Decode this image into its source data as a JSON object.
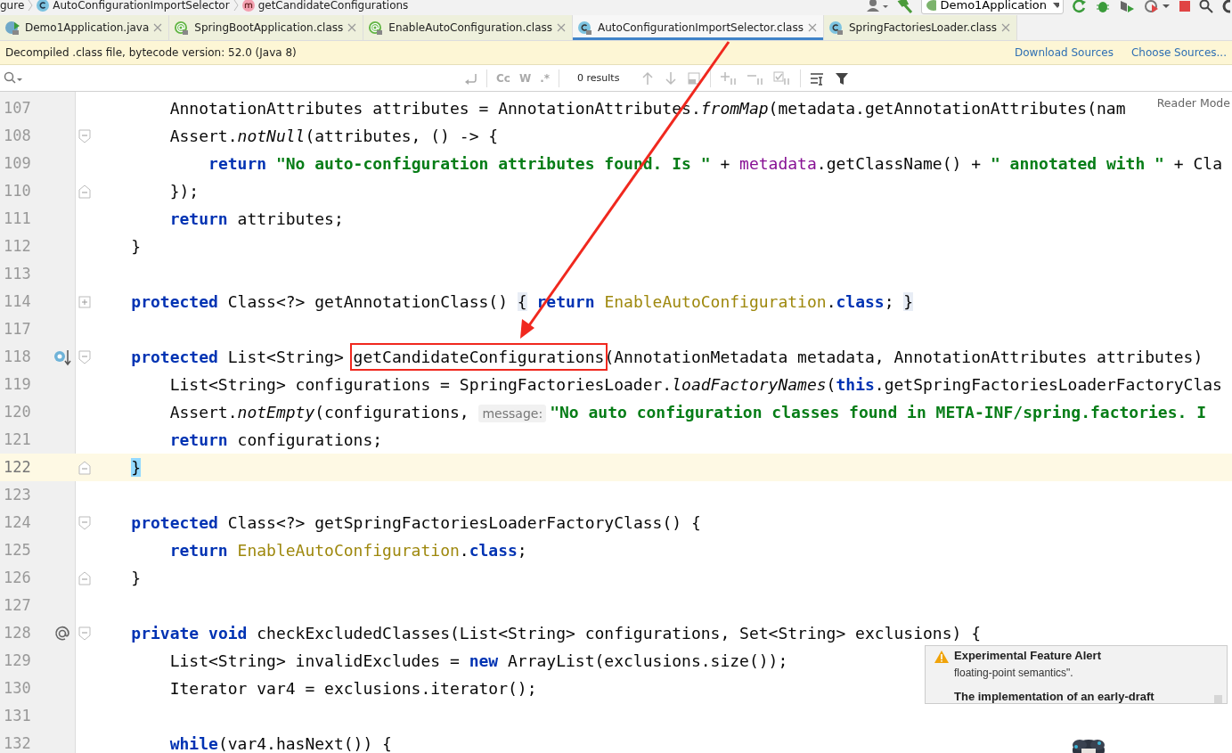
{
  "breadcrumb": [
    {
      "text": "gure",
      "kind": "plain"
    },
    {
      "text": "AutoConfigurationImportSelector",
      "kind": "class"
    },
    {
      "text": "getCandidateConfigurations",
      "kind": "method"
    }
  ],
  "toolbar": {
    "run_config": "Demo1Application"
  },
  "tabs": [
    {
      "label": "Demo1Application.java",
      "kind": "runnable",
      "selected": false
    },
    {
      "label": "SpringBootApplication.class",
      "kind": "annotation",
      "selected": false
    },
    {
      "label": "EnableAutoConfiguration.class",
      "kind": "annotation",
      "selected": false
    },
    {
      "label": "AutoConfigurationImportSelector.class",
      "kind": "class",
      "selected": true
    },
    {
      "label": "SpringFactoriesLoader.class",
      "kind": "class",
      "selected": false
    }
  ],
  "banner": {
    "text": "Decompiled .class file, bytecode version: 52.0 (Java 8)",
    "links": [
      "Download Sources",
      "Choose Sources..."
    ]
  },
  "search": {
    "options": [
      "Cc",
      "W",
      ".*"
    ],
    "results": "0 results"
  },
  "reader_mode": "Reader Mode",
  "lines": [
    {
      "number": "107",
      "kind": "line",
      "current": false,
      "tokens": [
        {
          "kind": "plain",
          "text": "        AnnotationAttributes attributes = AnnotationAttributes."
        },
        {
          "kind": "italic",
          "text": "fromMap"
        },
        {
          "kind": "plain",
          "text": "(metadata.getAnnotationAttributes(nam"
        }
      ]
    },
    {
      "number": "108",
      "kind": "open",
      "current": false,
      "tokens": [
        {
          "kind": "plain",
          "text": "        Assert."
        },
        {
          "kind": "italic",
          "text": "notNull"
        },
        {
          "kind": "plain",
          "text": "(attributes, () -> {"
        }
      ]
    },
    {
      "number": "109",
      "kind": "line",
      "current": false,
      "tokens": [
        {
          "kind": "keyword",
          "text": "            return"
        },
        {
          "kind": "string",
          "text": " \"No auto-configuration attributes found. Is \""
        },
        {
          "kind": "plain",
          "text": " + "
        },
        {
          "kind": "field",
          "text": "metadata"
        },
        {
          "kind": "plain",
          "text": ".getClassName() + "
        },
        {
          "kind": "string",
          "text": "\" annotated with \""
        },
        {
          "kind": "plain",
          "text": " + Cla"
        }
      ]
    },
    {
      "number": "110",
      "kind": "close",
      "current": false,
      "tokens": [
        {
          "kind": "plain",
          "text": "        });"
        }
      ]
    },
    {
      "number": "111",
      "kind": "line",
      "current": false,
      "tokens": [
        {
          "kind": "keyword",
          "text": "        return"
        },
        {
          "kind": "plain",
          "text": " attributes;"
        }
      ]
    },
    {
      "number": "112",
      "kind": "line",
      "current": false,
      "tokens": [
        {
          "kind": "plain",
          "text": "    }"
        }
      ]
    },
    {
      "number": "113",
      "kind": "line",
      "current": false
    },
    {
      "number": "114",
      "kind": "folded",
      "current": false,
      "tokens": [
        {
          "kind": "keyword",
          "text": "    protected"
        },
        {
          "kind": "plain",
          "text": " Class<?> getAnnotationClass() "
        },
        {
          "kind": "folded",
          "text": "{"
        },
        {
          "kind": "keyword",
          "text": " return"
        },
        {
          "kind": "classref",
          "text": " EnableAutoConfiguration"
        },
        {
          "kind": "plain",
          "text": "."
        },
        {
          "kind": "keyword",
          "text": "class"
        },
        {
          "kind": "plain",
          "text": "; "
        },
        {
          "kind": "folded",
          "text": "}"
        }
      ]
    },
    {
      "number": "117",
      "kind": "line",
      "current": false
    },
    {
      "number": "118",
      "kind": "override",
      "current": false,
      "tokens": [
        {
          "kind": "keyword",
          "text": "    protected"
        },
        {
          "kind": "plain",
          "text": " List<String> "
        },
        {
          "kind": "boxed",
          "text": "getCandidateConfigurations"
        },
        {
          "kind": "plain",
          "text": "(AnnotationMetadata metadata, AnnotationAttributes attributes)"
        }
      ]
    },
    {
      "number": "119",
      "kind": "line",
      "current": false,
      "tokens": [
        {
          "kind": "plain",
          "text": "        List<String> configurations = SpringFactoriesLoader."
        },
        {
          "kind": "italic",
          "text": "loadFactoryNames"
        },
        {
          "kind": "plain",
          "text": "("
        },
        {
          "kind": "keyword",
          "text": "this"
        },
        {
          "kind": "plain",
          "text": ".getSpringFactoriesLoaderFactoryClas"
        }
      ]
    },
    {
      "number": "120",
      "kind": "line",
      "current": false,
      "tokens": [
        {
          "kind": "plain",
          "text": "        Assert."
        },
        {
          "kind": "italic",
          "text": "notEmpty"
        },
        {
          "kind": "plain",
          "text": "(configurations, "
        },
        {
          "kind": "hint",
          "text": "message:"
        },
        {
          "kind": "string",
          "text": "\"No auto configuration classes found in META-INF/spring.factories. I"
        }
      ]
    },
    {
      "number": "121",
      "kind": "line",
      "current": false,
      "tokens": [
        {
          "kind": "keyword",
          "text": "        return"
        },
        {
          "kind": "plain",
          "text": " configurations;"
        }
      ]
    },
    {
      "number": "122",
      "kind": "close",
      "current": true,
      "tokens": [
        {
          "kind": "match",
          "text": "    }"
        }
      ]
    },
    {
      "number": "123",
      "kind": "line",
      "current": false
    },
    {
      "number": "124",
      "kind": "open",
      "current": false,
      "tokens": [
        {
          "kind": "keyword",
          "text": "    protected"
        },
        {
          "kind": "plain",
          "text": " Class<?> getSpringFactoriesLoaderFactoryClass() {"
        }
      ]
    },
    {
      "number": "125",
      "kind": "line",
      "current": false,
      "tokens": [
        {
          "kind": "keyword",
          "text": "        return"
        },
        {
          "kind": "classref",
          "text": " EnableAutoConfiguration"
        },
        {
          "kind": "plain",
          "text": "."
        },
        {
          "kind": "keyword",
          "text": "class"
        },
        {
          "kind": "plain",
          "text": ";"
        }
      ]
    },
    {
      "number": "126",
      "kind": "close",
      "current": false,
      "tokens": [
        {
          "kind": "plain",
          "text": "    }"
        }
      ]
    },
    {
      "number": "127",
      "kind": "line",
      "current": false
    },
    {
      "number": "128",
      "kind": "annotated",
      "current": false,
      "tokens": [
        {
          "kind": "keyword",
          "text": "    private void"
        },
        {
          "kind": "plain",
          "text": " checkExcludedClasses(List<String> configurations, Set<String> exclusions) {"
        }
      ]
    },
    {
      "number": "129",
      "kind": "line",
      "current": false,
      "tokens": [
        {
          "kind": "plain",
          "text": "        List<String> invalidExcludes = "
        },
        {
          "kind": "keyword",
          "text": "new"
        },
        {
          "kind": "plain",
          "text": " ArrayList(exclusions.size());"
        }
      ]
    },
    {
      "number": "130",
      "kind": "line",
      "current": false,
      "tokens": [
        {
          "kind": "plain",
          "text": "        Iterator var4 = exclusions.iterator();"
        }
      ]
    },
    {
      "number": "131",
      "kind": "line",
      "current": false
    },
    {
      "number": "132",
      "kind": "line",
      "current": false,
      "tokens": [
        {
          "kind": "keyword",
          "text": "        while"
        },
        {
          "kind": "plain",
          "text": "(var4.hasNext()) {"
        }
      ]
    }
  ],
  "notification": {
    "title": "Experimental Feature Alert",
    "body": "floating-point semantics\".",
    "bold_text": "The implementation of an early-draft"
  }
}
